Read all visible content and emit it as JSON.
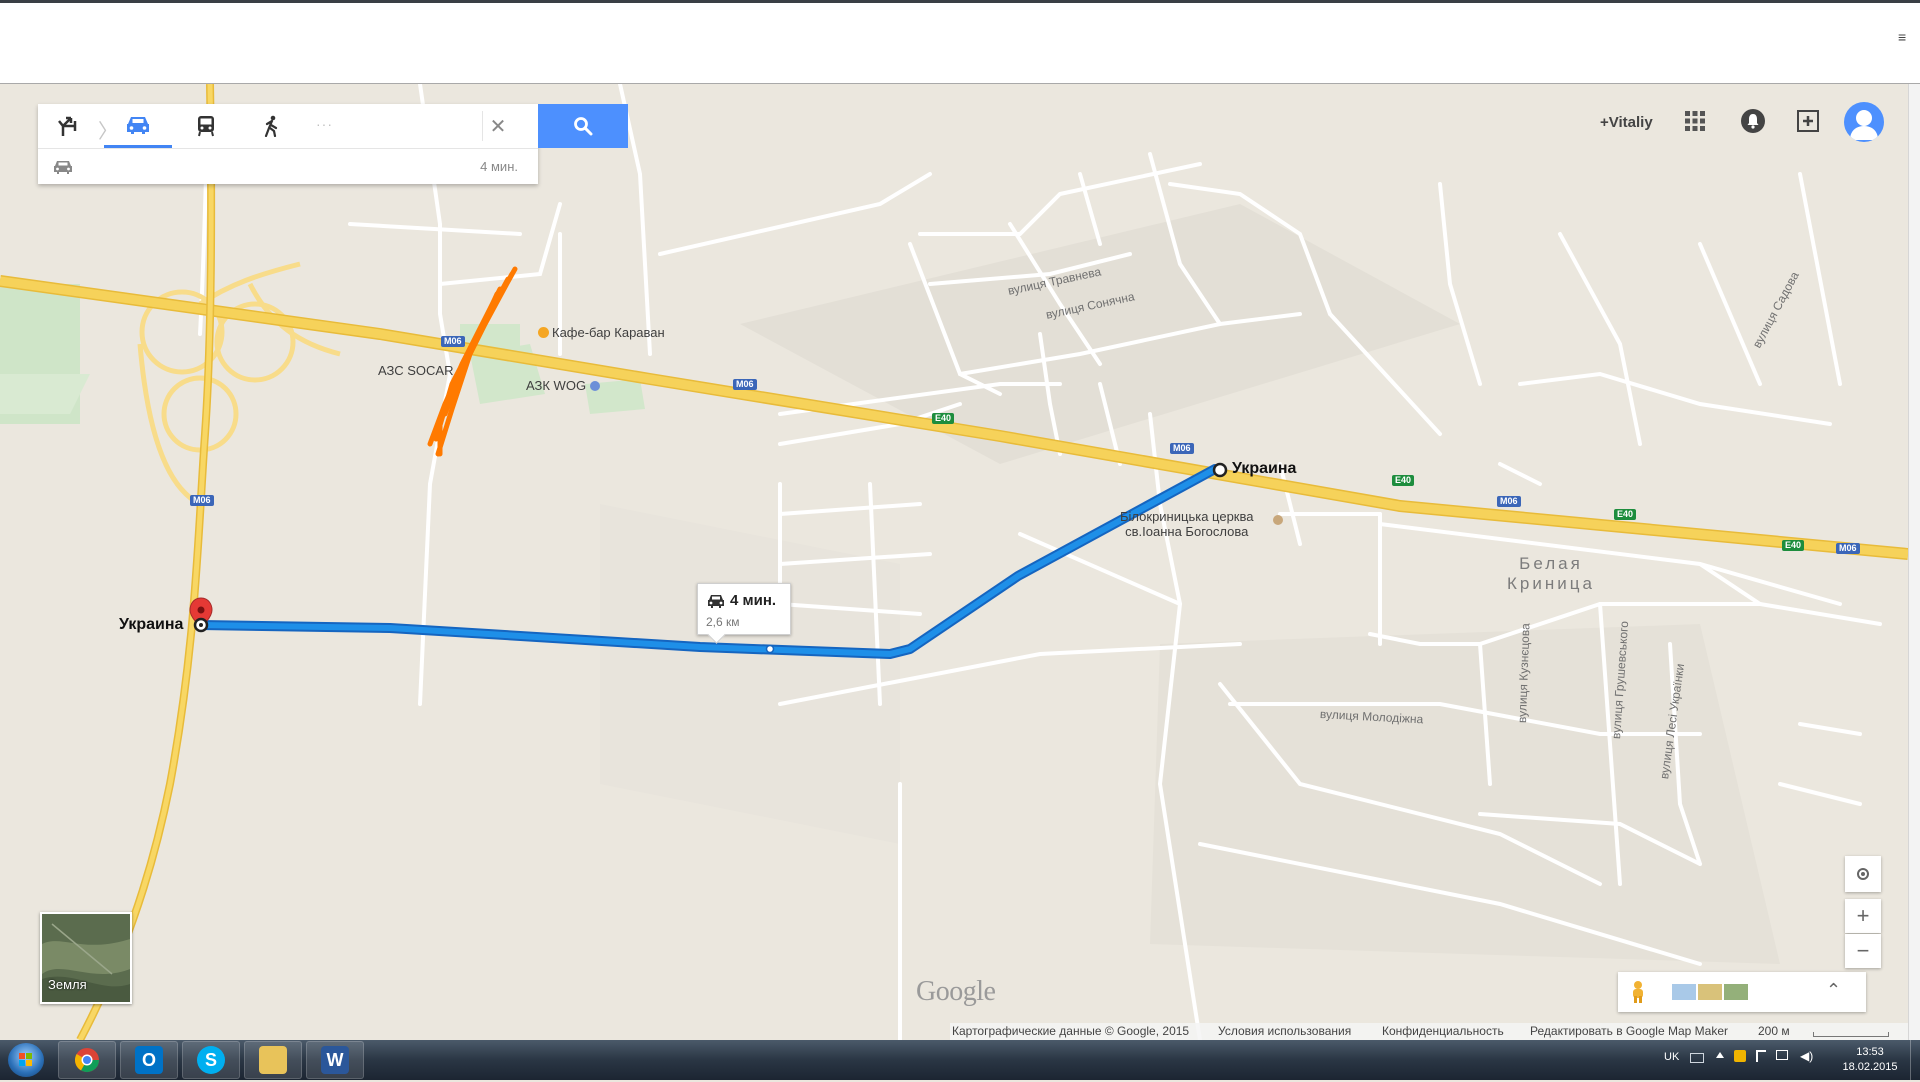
{
  "directions": {
    "modes": [
      {
        "name": "best-route",
        "active": false
      },
      {
        "name": "driving",
        "active": true
      },
      {
        "name": "transit",
        "active": false
      },
      {
        "name": "walking",
        "active": false
      }
    ],
    "more": "···",
    "summary_time": "4 мин."
  },
  "account": {
    "user": "+Vitaliy"
  },
  "map": {
    "route_box": {
      "time": "4 мин.",
      "distance": "2,6 км"
    },
    "waypoints": {
      "start": "Украина",
      "end": "Украина"
    },
    "road_badges": {
      "m06": "M06",
      "e40": "E40"
    },
    "pois": {
      "cafe": "Кафе-бар Караван",
      "socar": "АЗС SOCAR",
      "wog": "АЗК WOG",
      "church_line1": "Білокриницька церква",
      "church_line2": "св.Іоанна Богослова"
    },
    "streets": {
      "travneva": "вулиця Травнева",
      "sonyachna": "вулиця Сонячна",
      "sadova": "вулиця Садова",
      "molodizhna": "вулиця Молодіжна",
      "kuznetsova": "вулиця Кузнєцова",
      "hrushevskoho": "вулиця Грушевського",
      "lesi": "вулиця Лесі Українки"
    },
    "town": {
      "line1": "Белая",
      "line2": "Криница"
    },
    "earth_label": "Земля",
    "logo": "Google",
    "zoom_in": "+",
    "zoom_out": "−"
  },
  "footer": {
    "copyright": "Картографические данные © Google, 2015",
    "terms": "Условия использования",
    "privacy": "Конфиденциальность",
    "edit": "Редактировать в Google Map Maker",
    "scale": "200 м"
  },
  "taskbar": {
    "lang": "UK",
    "time": "13:53",
    "date": "18.02.2015",
    "apps": [
      "chrome",
      "outlook",
      "skype",
      "explorer",
      "word"
    ]
  },
  "colors": {
    "route": "#1e8fe8",
    "highway": "#f6d25a",
    "annotation": "#ff7a00",
    "search": "#4d90fe"
  }
}
